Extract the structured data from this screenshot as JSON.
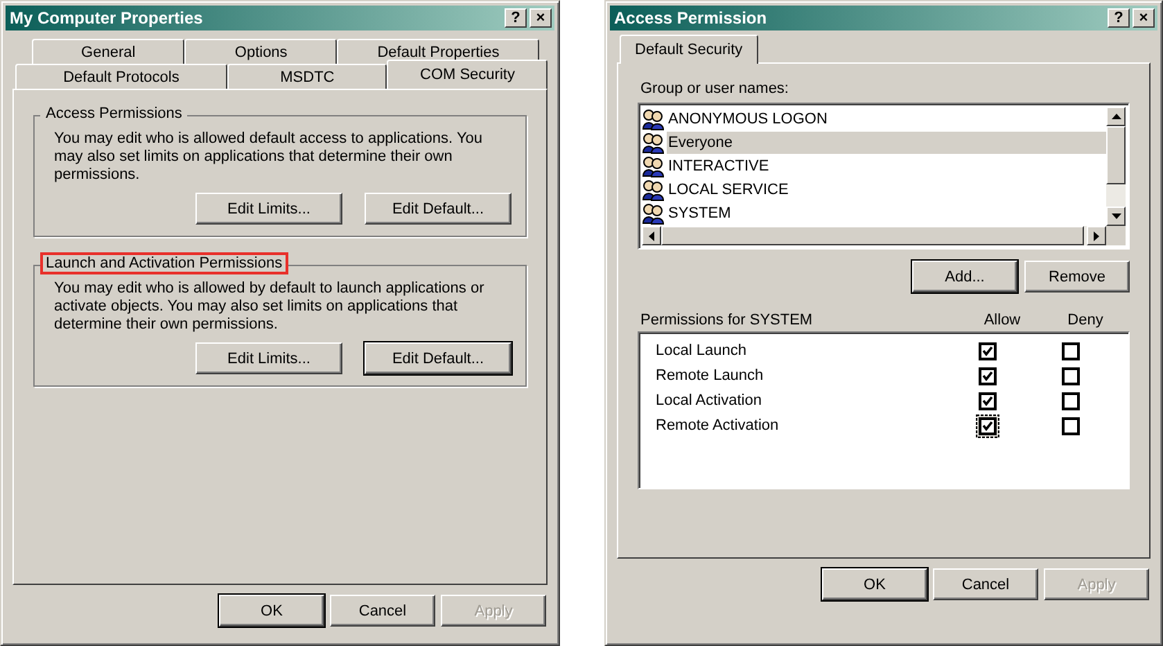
{
  "windows": [
    {
      "kind": "properties",
      "title": "My Computer Properties",
      "help_button": "?",
      "close_button": "×",
      "tab_rows": [
        [
          {
            "label": "General",
            "selected": false
          },
          {
            "label": "Options",
            "selected": false
          },
          {
            "label": "Default Properties",
            "selected": false
          }
        ],
        [
          {
            "label": "Default Protocols",
            "selected": false
          },
          {
            "label": "MSDTC",
            "selected": false
          },
          {
            "label": "COM Security",
            "selected": true
          }
        ]
      ],
      "groups": [
        {
          "legend": "Access Permissions",
          "highlighted": false,
          "text": "You may edit who is allowed default access to applications. You may also set limits on applications that determine their own permissions.",
          "buttons": [
            {
              "label": "Edit Limits...",
              "default": false
            },
            {
              "label": "Edit Default...",
              "default": false
            }
          ]
        },
        {
          "legend": "Launch and Activation Permissions",
          "highlighted": true,
          "text": "You may edit who is allowed by default to launch applications or activate objects. You may also set limits on applications that determine their own permissions.",
          "buttons": [
            {
              "label": "Edit Limits...",
              "default": false
            },
            {
              "label": "Edit Default...",
              "default": true
            }
          ]
        }
      ],
      "footer_buttons": [
        {
          "label": "OK",
          "default": true,
          "disabled": false
        },
        {
          "label": "Cancel",
          "default": false,
          "disabled": false
        },
        {
          "label": "Apply",
          "default": false,
          "disabled": true
        }
      ]
    },
    {
      "kind": "permissions",
      "title": "Access Permission",
      "help_button": "?",
      "close_button": "×",
      "tab_rows": [
        [
          {
            "label": "Default Security",
            "selected": true
          }
        ]
      ],
      "users_label": "Group or user names:",
      "users": [
        {
          "name": "ANONYMOUS LOGON",
          "selected": false
        },
        {
          "name": "Everyone",
          "selected": true
        },
        {
          "name": "INTERACTIVE",
          "selected": false
        },
        {
          "name": "LOCAL SERVICE",
          "selected": false
        },
        {
          "name": "SYSTEM",
          "selected": false
        }
      ],
      "user_buttons": [
        {
          "label": "Add...",
          "default": true
        },
        {
          "label": "Remove",
          "default": false
        }
      ],
      "permissions_label": "Permissions for SYSTEM",
      "allow_label": "Allow",
      "deny_label": "Deny",
      "permissions": [
        {
          "name": "Local Launch",
          "allow": true,
          "deny": false,
          "focused": false
        },
        {
          "name": "Remote Launch",
          "allow": true,
          "deny": false,
          "focused": false
        },
        {
          "name": "Local Activation",
          "allow": true,
          "deny": false,
          "focused": false
        },
        {
          "name": "Remote Activation",
          "allow": true,
          "deny": false,
          "focused": true
        }
      ],
      "footer_buttons": [
        {
          "label": "OK",
          "default": true,
          "disabled": false
        },
        {
          "label": "Cancel",
          "default": false,
          "disabled": false
        },
        {
          "label": "Apply",
          "default": false,
          "disabled": true
        }
      ]
    }
  ]
}
